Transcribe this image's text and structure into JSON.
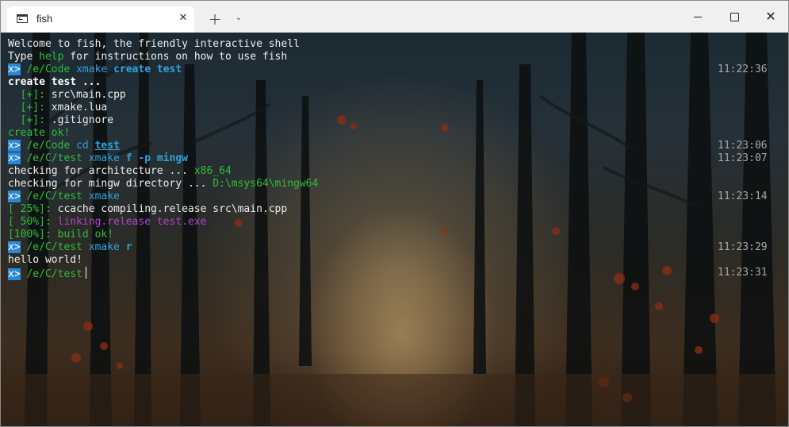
{
  "window": {
    "tab_title": "fish",
    "close_tab_glyph": "✕",
    "new_tab_glyph": "+",
    "dropdown_glyph": "⌄",
    "close_glyph": "✕"
  },
  "terminal": {
    "prompt_symbol": "x>",
    "lines": [
      {
        "id": "l0",
        "segments": [
          {
            "t": "Welcome to fish, the friendly interactive shell",
            "s": "w"
          }
        ]
      },
      {
        "id": "l1",
        "segments": [
          {
            "t": "Type ",
            "s": "w"
          },
          {
            "t": "help",
            "s": "g"
          },
          {
            "t": " for instructions on how to use fish",
            "s": "w"
          }
        ]
      },
      {
        "id": "l2",
        "prompt": true,
        "segments": [
          {
            "t": " /e/Code ",
            "s": "g"
          },
          {
            "t": "xmake ",
            "s": "c"
          },
          {
            "t": "create test",
            "s": "cb"
          }
        ],
        "time": "11:22:36"
      },
      {
        "id": "l3",
        "segments": [
          {
            "t": "create test ...",
            "s": "wb"
          }
        ]
      },
      {
        "id": "l4",
        "segments": [
          {
            "t": "  [+]: ",
            "s": "g"
          },
          {
            "t": "src\\main.cpp",
            "s": "w"
          }
        ]
      },
      {
        "id": "l5",
        "segments": [
          {
            "t": "  [+]: ",
            "s": "g"
          },
          {
            "t": "xmake.lua",
            "s": "w"
          }
        ]
      },
      {
        "id": "l6",
        "segments": [
          {
            "t": "  [+]: ",
            "s": "g"
          },
          {
            "t": ".gitignore",
            "s": "w"
          }
        ]
      },
      {
        "id": "l7",
        "segments": [
          {
            "t": "create ok!",
            "s": "g"
          }
        ]
      },
      {
        "id": "l8",
        "prompt": true,
        "segments": [
          {
            "t": " /e/Code ",
            "s": "g"
          },
          {
            "t": "cd ",
            "s": "c"
          },
          {
            "t": "test",
            "s": "u"
          }
        ],
        "time": "11:23:06"
      },
      {
        "id": "l9",
        "prompt": true,
        "segments": [
          {
            "t": " /e/C/test ",
            "s": "g"
          },
          {
            "t": "xmake ",
            "s": "c"
          },
          {
            "t": "f -p mingw",
            "s": "cb"
          }
        ],
        "time": "11:23:07"
      },
      {
        "id": "l10",
        "segments": [
          {
            "t": "checking for architecture ... ",
            "s": "w"
          },
          {
            "t": "x86_64",
            "s": "g"
          }
        ]
      },
      {
        "id": "l11",
        "segments": [
          {
            "t": "checking for mingw directory ... ",
            "s": "w"
          },
          {
            "t": "D:\\msys64\\mingw64",
            "s": "g"
          }
        ]
      },
      {
        "id": "l12",
        "prompt": true,
        "segments": [
          {
            "t": " /e/C/test ",
            "s": "g"
          },
          {
            "t": "xmake",
            "s": "c"
          }
        ],
        "time": "11:23:14"
      },
      {
        "id": "l13",
        "segments": [
          {
            "t": "[ 25%]: ",
            "s": "g"
          },
          {
            "t": "ccache compiling.release src\\main.cpp",
            "s": "w"
          }
        ]
      },
      {
        "id": "l14",
        "segments": [
          {
            "t": "[ 50%]: ",
            "s": "g"
          },
          {
            "t": "linking.release test.exe",
            "s": "m"
          }
        ]
      },
      {
        "id": "l15",
        "segments": [
          {
            "t": "[100%]: ",
            "s": "g"
          },
          {
            "t": "build ok!",
            "s": "g"
          }
        ]
      },
      {
        "id": "l16",
        "prompt": true,
        "segments": [
          {
            "t": " /e/C/test ",
            "s": "g"
          },
          {
            "t": "xmake ",
            "s": "c"
          },
          {
            "t": "r",
            "s": "cb"
          }
        ],
        "time": "11:23:29"
      },
      {
        "id": "l17",
        "segments": [
          {
            "t": "hello world!",
            "s": "w"
          }
        ]
      },
      {
        "id": "l18",
        "prompt": true,
        "cursor": true,
        "segments": [
          {
            "t": " /e/C/test",
            "s": "g"
          }
        ],
        "time": "11:23:31"
      }
    ]
  }
}
